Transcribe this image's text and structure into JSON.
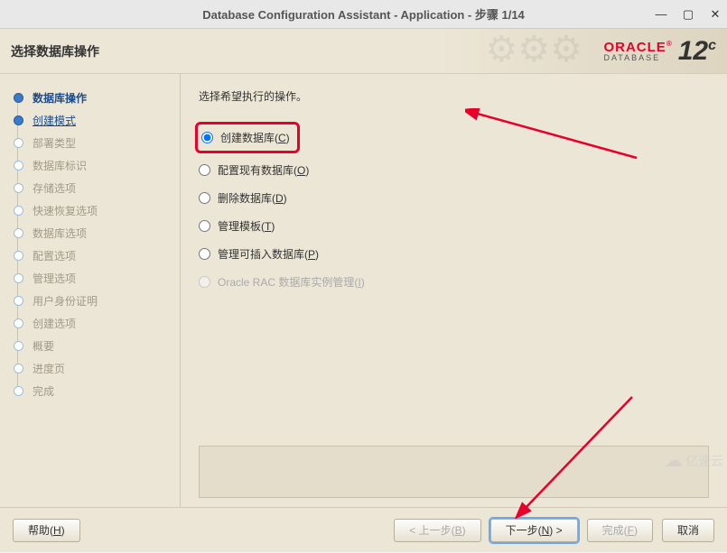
{
  "titlebar": {
    "title": "Database Configuration Assistant - Application - 步骤 1/14"
  },
  "header": {
    "title": "选择数据库操作",
    "brand": "ORACLE",
    "brand_sub": "DATABASE",
    "version": "12",
    "version_suffix": "c"
  },
  "sidebar": {
    "steps": [
      {
        "label": "数据库操作",
        "state": "active"
      },
      {
        "label": "创建模式",
        "state": "link"
      },
      {
        "label": "部署类型",
        "state": "disabled"
      },
      {
        "label": "数据库标识",
        "state": "disabled"
      },
      {
        "label": "存储选项",
        "state": "disabled"
      },
      {
        "label": "快速恢复选项",
        "state": "disabled"
      },
      {
        "label": "数据库选项",
        "state": "disabled"
      },
      {
        "label": "配置选项",
        "state": "disabled"
      },
      {
        "label": "管理选项",
        "state": "disabled"
      },
      {
        "label": "用户身份证明",
        "state": "disabled"
      },
      {
        "label": "创建选项",
        "state": "disabled"
      },
      {
        "label": "概要",
        "state": "disabled"
      },
      {
        "label": "进度页",
        "state": "disabled"
      },
      {
        "label": "完成",
        "state": "disabled"
      }
    ]
  },
  "content": {
    "instruction": "选择希望执行的操作。",
    "options": [
      {
        "label_pre": "创建数据库(",
        "hotkey": "C",
        "label_post": ")",
        "selected": true,
        "enabled": true,
        "highlighted": true
      },
      {
        "label_pre": "配置现有数据库(",
        "hotkey": "O",
        "label_post": ")",
        "selected": false,
        "enabled": true
      },
      {
        "label_pre": "删除数据库(",
        "hotkey": "D",
        "label_post": ")",
        "selected": false,
        "enabled": true
      },
      {
        "label_pre": "管理模板(",
        "hotkey": "T",
        "label_post": ")",
        "selected": false,
        "enabled": true
      },
      {
        "label_pre": "管理可插入数据库(",
        "hotkey": "P",
        "label_post": ")",
        "selected": false,
        "enabled": true
      },
      {
        "label_pre": "Oracle RAC 数据库实例管理(",
        "hotkey": "I",
        "label_post": ")",
        "selected": false,
        "enabled": false
      }
    ]
  },
  "footer": {
    "help": {
      "pre": "帮助(",
      "hk": "H",
      "post": ")"
    },
    "back": {
      "pre": "< 上一步(",
      "hk": "B",
      "post": ")"
    },
    "next": {
      "pre": "下一步(",
      "hk": "N",
      "post": ") >"
    },
    "finish": {
      "pre": "完成(",
      "hk": "F",
      "post": ")"
    },
    "cancel": "取消"
  },
  "watermark": "亿速云"
}
